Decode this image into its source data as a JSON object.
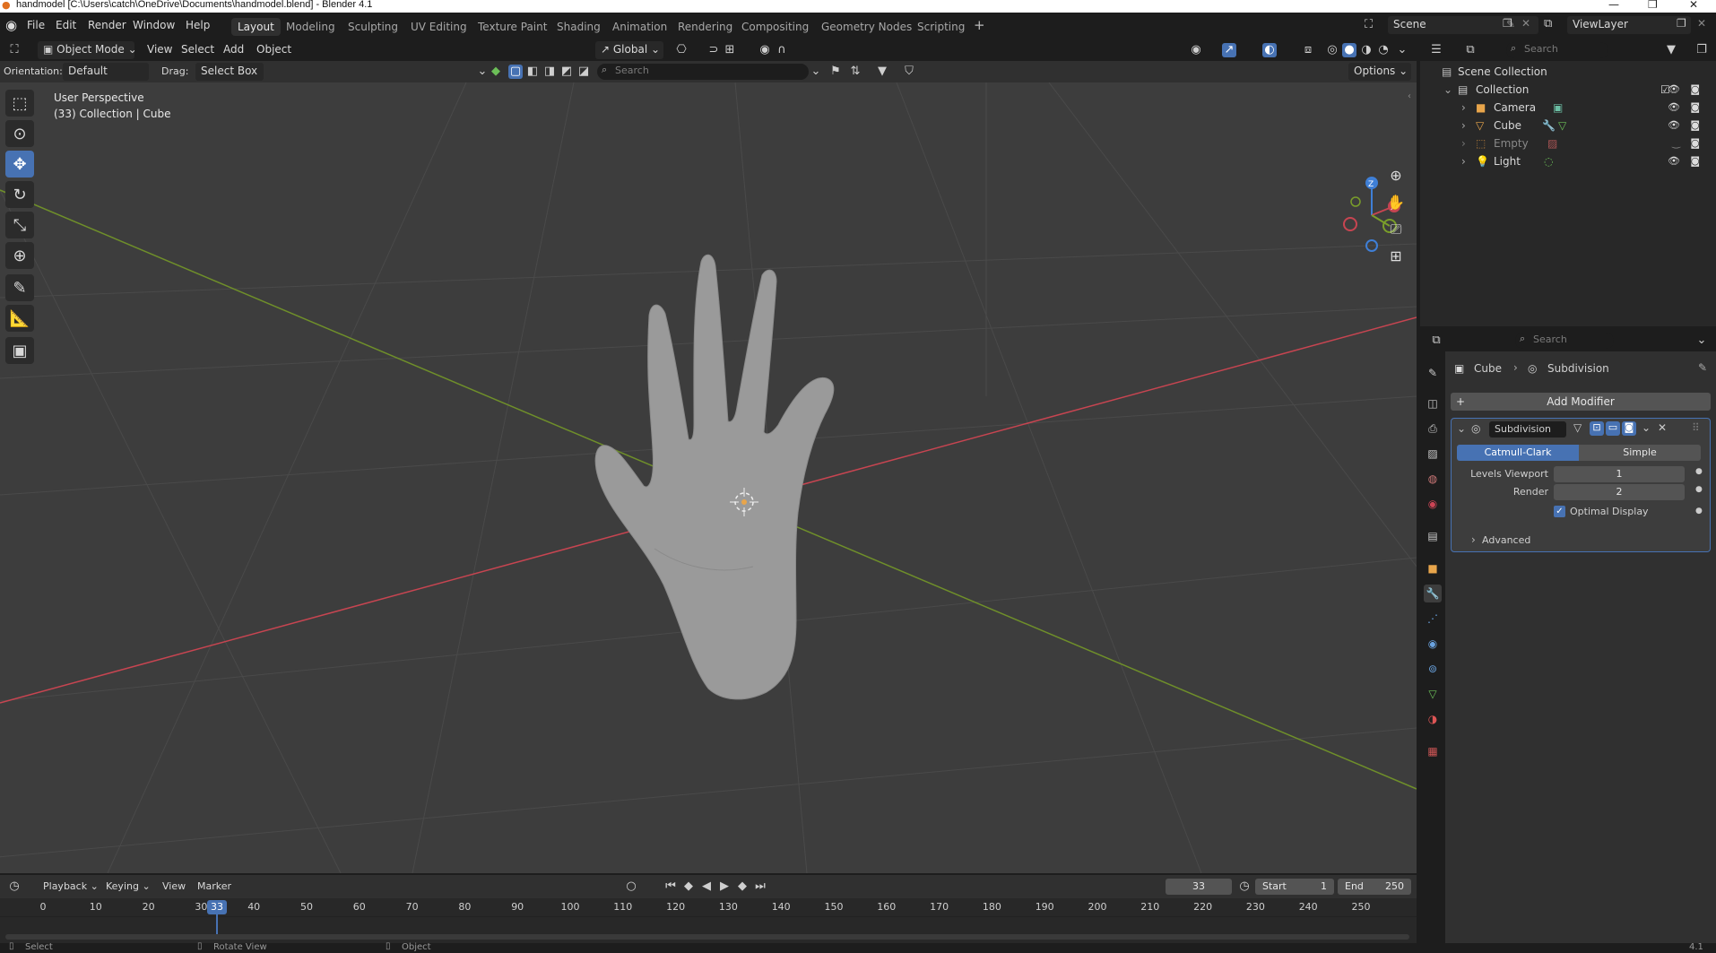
{
  "window": {
    "title": "handmodel [C:\\Users\\catch\\OneDrive\\Documents\\handmodel.blend] - Blender 4.1"
  },
  "menu": [
    "File",
    "Edit",
    "Render",
    "Window",
    "Help"
  ],
  "workspaces": [
    "Layout",
    "Modeling",
    "Sculpting",
    "UV Editing",
    "Texture Paint",
    "Shading",
    "Animation",
    "Rendering",
    "Compositing",
    "Geometry Nodes",
    "Scripting"
  ],
  "scene": {
    "label": "Scene",
    "view_layer": "ViewLayer"
  },
  "viewport_header": {
    "mode": "Object Mode",
    "menus": [
      "View",
      "Select",
      "Add",
      "Object"
    ],
    "transform_orientation": "Global",
    "orientation_label": "Orientation:",
    "orientation_value": "Default",
    "drag_label": "Drag:",
    "drag_value": "Select Box",
    "search_placeholder": "Search",
    "options_label": "Options"
  },
  "viewport": {
    "perspective": "User Perspective",
    "collection_info": "(33) Collection | Cube",
    "gizmo_axes": [
      "X",
      "Y",
      "Z"
    ]
  },
  "outliner": {
    "search_placeholder": "Search",
    "root": "Scene Collection",
    "collection": "Collection",
    "items": [
      {
        "name": "Camera",
        "color": "#e8a54b"
      },
      {
        "name": "Cube",
        "color": "#e8a54b"
      },
      {
        "name": "Empty",
        "color": "#e8a54b"
      },
      {
        "name": "Light",
        "color": "#e8a54b"
      }
    ]
  },
  "properties": {
    "search_placeholder": "Search",
    "breadcrumb_object": "Cube",
    "breadcrumb_modifier": "Subdivision",
    "add_modifier": "Add Modifier",
    "modifier_name": "Subdivision",
    "method_active": "Catmull-Clark",
    "method_other": "Simple",
    "levels_viewport_label": "Levels Viewport",
    "levels_viewport_value": "1",
    "render_label": "Render",
    "render_value": "2",
    "optimal_display": "Optimal Display",
    "advanced": "Advanced"
  },
  "timeline": {
    "menus": [
      "Playback",
      "Keying",
      "View",
      "Marker"
    ],
    "current_frame": "33",
    "start_label": "Start",
    "start_value": "1",
    "end_label": "End",
    "end_value": "250",
    "ticks": [
      "0",
      "10",
      "20",
      "30",
      "40",
      "50",
      "60",
      "70",
      "80",
      "90",
      "100",
      "110",
      "120",
      "130",
      "140",
      "150",
      "160",
      "170",
      "180",
      "190",
      "200",
      "210",
      "220",
      "230",
      "240",
      "250"
    ]
  },
  "statusbar": {
    "select": "Select",
    "rotate": "Rotate View",
    "object": "Object",
    "version": "4.1"
  },
  "colors": {
    "accent": "#4772b3",
    "viewport_bg": "#3d3d3d",
    "x_axis": "#c74551",
    "y_axis": "#7a9e2a",
    "object_orange": "#e8a54b"
  }
}
